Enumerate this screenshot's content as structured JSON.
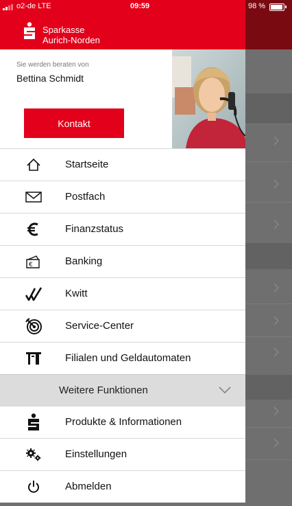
{
  "status_bar": {
    "carrier": "o2-de  LTE",
    "time": "09:59",
    "battery": "98 %"
  },
  "header": {
    "bank_name_line1": "Sparkasse",
    "bank_name_line2": "Aurich-Norden"
  },
  "advisor": {
    "caption": "Sie werden beraten von",
    "name": "Bettina Schmidt",
    "contact_label": "Kontakt"
  },
  "menu": {
    "items": [
      {
        "label": "Startseite",
        "icon": "home-icon"
      },
      {
        "label": "Postfach",
        "icon": "mail-icon"
      },
      {
        "label": "Finanzstatus",
        "icon": "euro-icon"
      },
      {
        "label": "Banking",
        "icon": "wallet-icon"
      },
      {
        "label": "Kwitt",
        "icon": "kwitt-icon"
      },
      {
        "label": "Service-Center",
        "icon": "target-icon"
      },
      {
        "label": "Filialen und Geldautomaten",
        "icon": "atm-icon"
      }
    ],
    "section_label": "Weitere Funktionen",
    "more_items": [
      {
        "label": "Produkte & Informationen",
        "icon": "sparkasse-logo-icon"
      },
      {
        "label": "Einstellungen",
        "icon": "gears-icon"
      },
      {
        "label": "Abmelden",
        "icon": "power-icon"
      }
    ]
  },
  "colors": {
    "brand_red": "#e2001a",
    "overlay": "#6f6f6f"
  }
}
